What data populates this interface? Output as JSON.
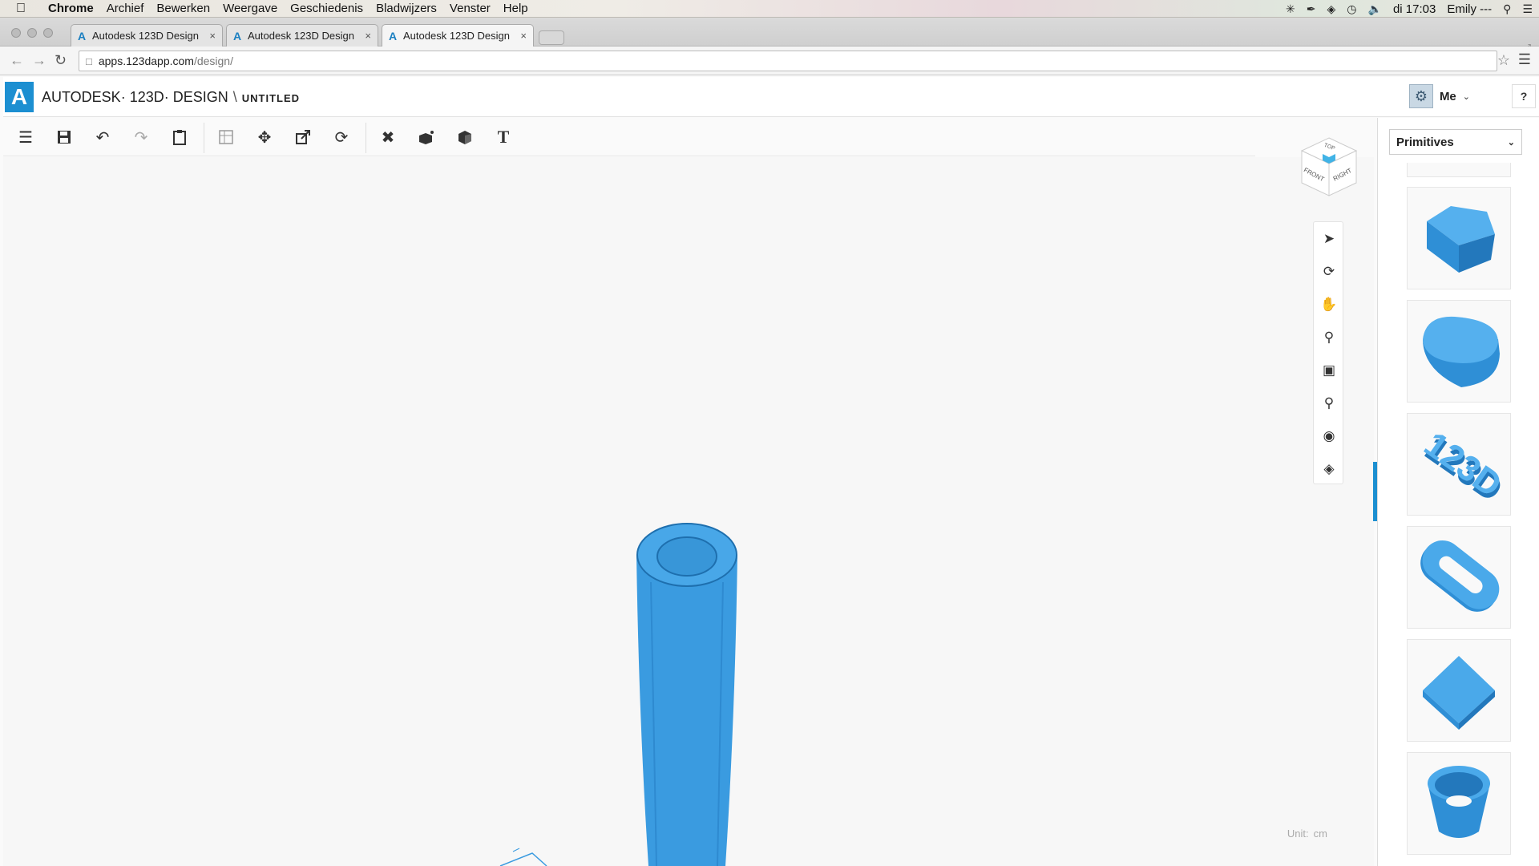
{
  "menubar": {
    "app": "Chrome",
    "items": [
      "Archief",
      "Bewerken",
      "Weergave",
      "Geschiedenis",
      "Bladwijzers",
      "Venster",
      "Help"
    ],
    "clock": "di 17:03",
    "user": "Emily ---"
  },
  "tabs": [
    {
      "title": "Autodesk 123D Design"
    },
    {
      "title": "Autodesk 123D Design"
    },
    {
      "title": "Autodesk 123D Design"
    }
  ],
  "address": {
    "host": "apps.123dapp.com",
    "path": "/design/"
  },
  "app": {
    "brand": "AUTODESK· 123D· DESIGN",
    "separator": "\\",
    "document": "UNTITLED",
    "user_label": "Me",
    "help_label": "?"
  },
  "toolbar": {
    "icons": [
      "menu-icon",
      "save-icon",
      "undo-icon",
      "redo-icon",
      "clipboard-icon",
      "sketch-icon",
      "move-icon",
      "scale-icon",
      "rotate-icon",
      "modify-icon",
      "combine-icon",
      "material-icon",
      "text-icon"
    ]
  },
  "viewcube": {
    "top": "TOP",
    "front": "FRONT",
    "right": "RIGHT"
  },
  "navbar": {
    "icons": [
      "select-icon",
      "orbit-icon",
      "pan-icon",
      "zoom-icon",
      "fit-icon",
      "zoom-selected-icon",
      "visibility-icon",
      "material-view-icon"
    ]
  },
  "panel": {
    "category": "Primitives",
    "items": [
      "pentagon-prism",
      "rounded-cylinder",
      "text-123d",
      "torus-link",
      "rhombus-plate",
      "tube"
    ]
  },
  "status": {
    "unit_label": "Unit:",
    "unit_value": "cm"
  },
  "colors": {
    "accent": "#1c8fd1",
    "shape": "#3a9be0",
    "shape_dark": "#2176b5"
  }
}
